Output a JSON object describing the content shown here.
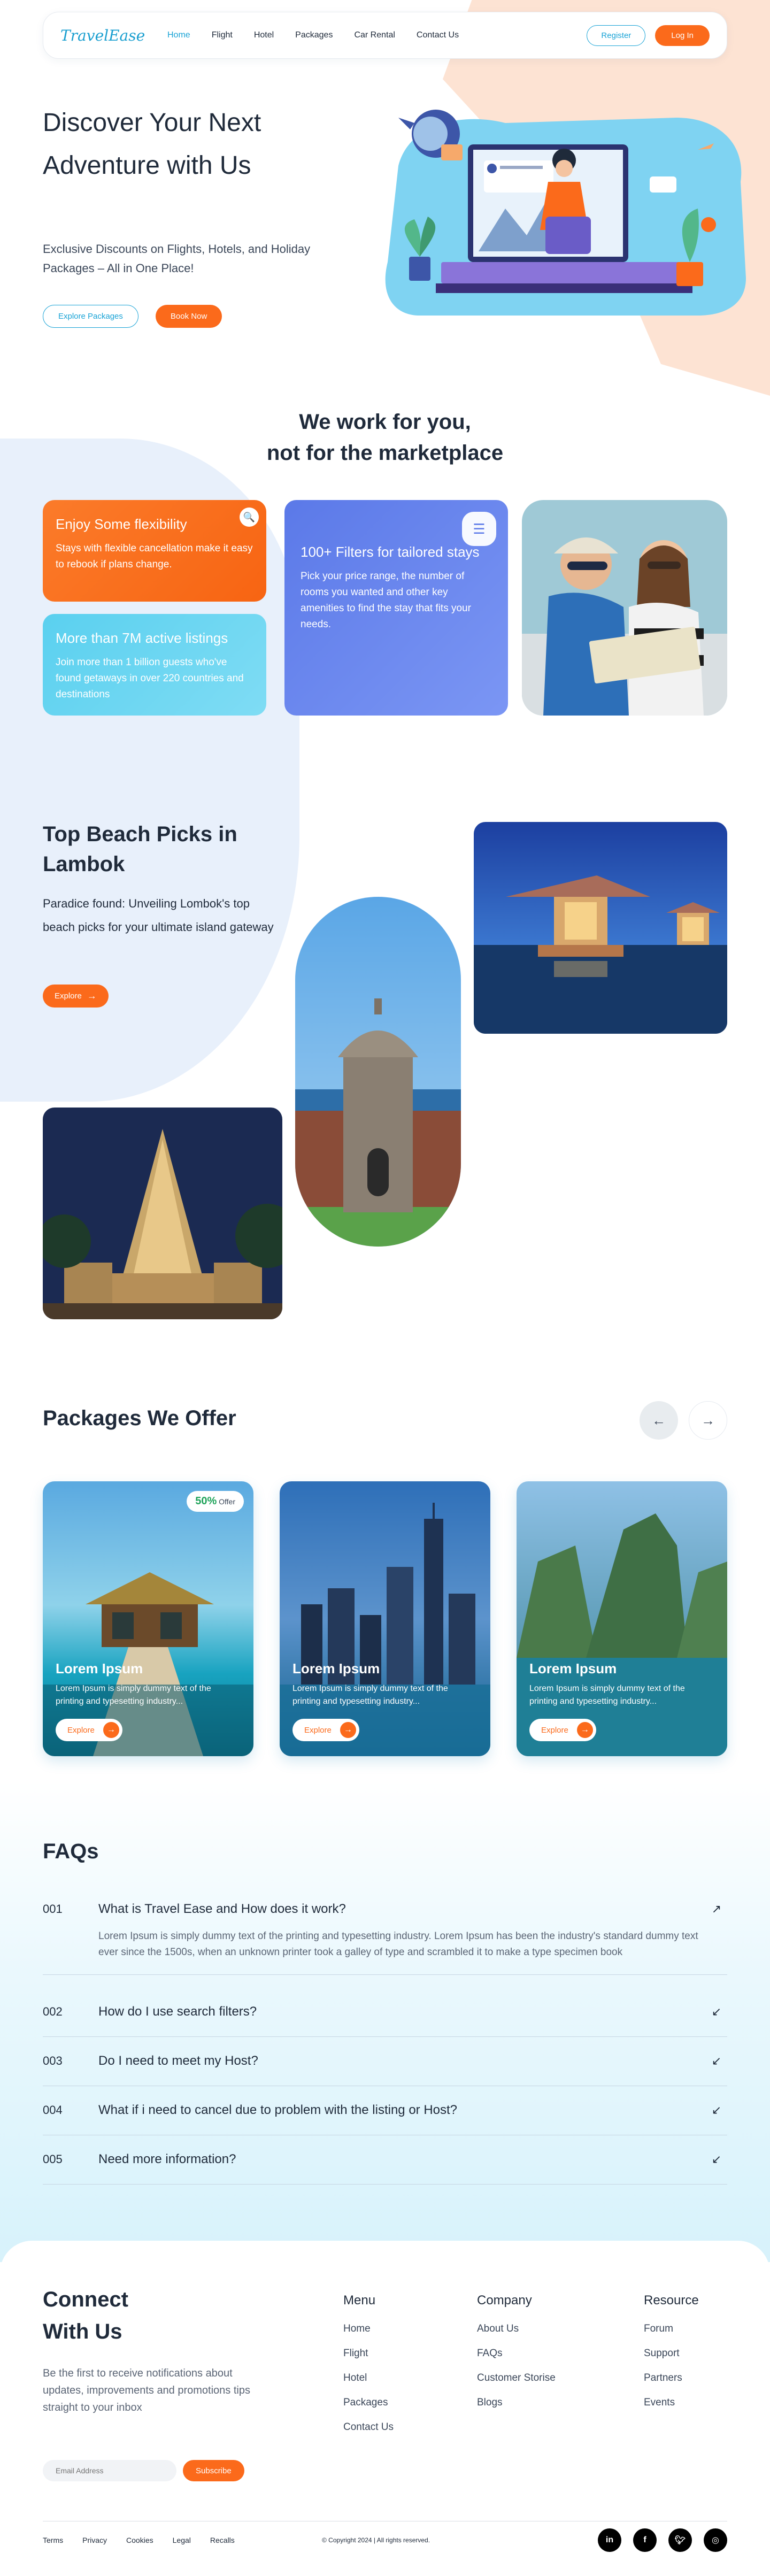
{
  "brand": {
    "logo": "TravelEase"
  },
  "nav": {
    "links": [
      "Home",
      "Flight",
      "Hotel",
      "Packages",
      "Car Rental",
      "Contact Us"
    ],
    "register": "Register",
    "login": "Log In"
  },
  "hero": {
    "title": "Discover Your Next Adventure with Us",
    "subtitle": "Exclusive Discounts on Flights, Hotels, and Holiday Packages – All in One Place!",
    "explore": "Explore Packages",
    "book": "Book Now"
  },
  "work": {
    "title_line1": "We work for you,",
    "title_line2": "not for the marketplace",
    "card1_title": "Enjoy Some flexibility",
    "card1_text": "Stays with flexible cancellation make it easy to rebook if plans change.",
    "card2_title": "More than 7M active listings",
    "card2_text": "Join more than 1 billion guests who've found getaways in over 220 countries and destinations",
    "card3_title": "100+ Filters for tailored stays",
    "card3_text": "Pick your price range, the number of rooms you wanted and other key amenities to find the stay that fits your needs."
  },
  "beach": {
    "title": "Top Beach Picks in Lambok",
    "subtitle": "Paradice found: Unveiling Lombok's top beach picks for your ultimate island gateway",
    "explore": "Explore"
  },
  "packages": {
    "title": "Packages We Offer",
    "offer_pct": "50%",
    "offer_label": "Offer",
    "cards": [
      {
        "title": "Lorem Ipsum",
        "text": "Lorem Ipsum is simply dummy text of the printing and typesetting industry...",
        "cta": "Explore"
      },
      {
        "title": "Lorem Ipsum",
        "text": "Lorem Ipsum is simply dummy text of the printing and typesetting industry...",
        "cta": "Explore"
      },
      {
        "title": "Lorem Ipsum",
        "text": "Lorem Ipsum is simply dummy text of the printing and typesetting industry...",
        "cta": "Explore"
      }
    ]
  },
  "faq": {
    "title": "FAQs",
    "items": [
      {
        "num": "001",
        "q": "What is Travel Ease and How does it work?",
        "a": "Lorem Ipsum is simply dummy text of the printing and typesetting industry. Lorem Ipsum has been the industry's standard dummy text ever since the 1500s, when an unknown printer took a galley of type and scrambled it to make a type specimen book"
      },
      {
        "num": "002",
        "q": "How do I use search filters?"
      },
      {
        "num": "003",
        "q": "Do I need to meet my Host?"
      },
      {
        "num": "004",
        "q": "What if i need to cancel due to problem with the listing or Host?"
      },
      {
        "num": "005",
        "q": "Need more information?"
      }
    ]
  },
  "footer": {
    "connect_line1": "Connect",
    "connect_line2": "With Us",
    "subtitle": "Be the first to receive notifications about updates, improvements and promotions tips straight to your inbox",
    "email_placeholder": "Email Address",
    "subscribe": "Subscribe",
    "menu_title": "Menu",
    "menu": [
      "Home",
      "Flight",
      "Hotel",
      "Packages",
      "Contact Us"
    ],
    "company_title": "Company",
    "company": [
      "About Us",
      "FAQs",
      "Customer Storise",
      "Blogs"
    ],
    "resource_title": "Resource",
    "resource": [
      "Forum",
      "Support",
      "Partners",
      "Events"
    ],
    "legal": [
      "Terms",
      "Privacy",
      "Cookies",
      "Legal",
      "Recalls"
    ],
    "copyright": "© Copyright 2024 | All rights reserved."
  },
  "colors": {
    "primary": "#19a3d6",
    "accent": "#fb6a1b",
    "indigo": "#5b79e8",
    "cyan": "#5ad0ef"
  }
}
